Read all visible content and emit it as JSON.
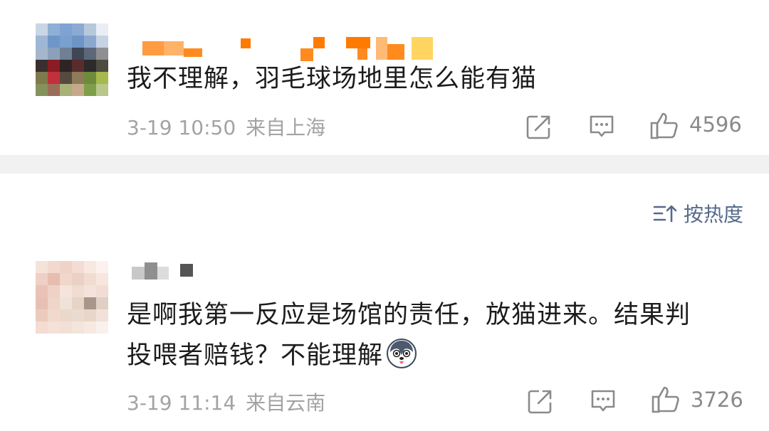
{
  "comments": [
    {
      "text": "我不理解，羽毛球场地里怎么能有猫",
      "time": "3-19 10:50",
      "location": "来自上海",
      "likes": "4596",
      "icons": [
        "repost-icon",
        "comment-icon",
        "like-icon"
      ]
    },
    {
      "text_line1": "是啊我第一反应是场馆的责任，放猫进来。结果判",
      "text_line2": "投喂者赔钱？不能理解",
      "emoji": "husky-emoji",
      "time": "3-19 11:14",
      "location": "来自云南",
      "likes": "3726",
      "icons": [
        "repost-icon",
        "comment-icon",
        "like-icon"
      ]
    }
  ],
  "sort": {
    "label": "按热度",
    "icon": "sort-icon"
  },
  "colors": {
    "text": "#1c1c1c",
    "meta": "#a3a3a3",
    "sort": "#566a8a",
    "divider": "#f1f1f1",
    "username_redact": "#ff8a1e"
  }
}
